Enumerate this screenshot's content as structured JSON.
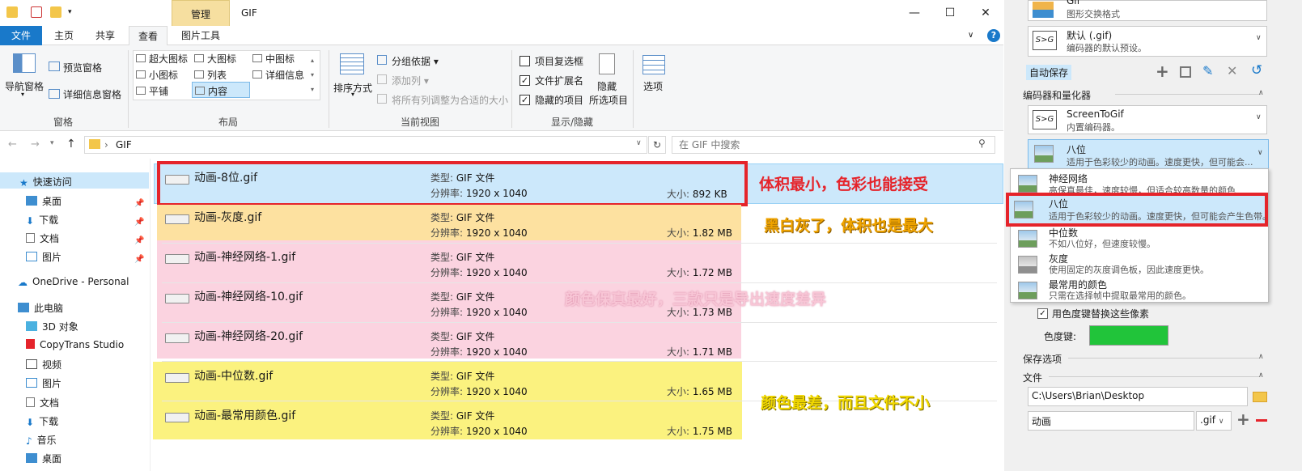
{
  "window": {
    "title": "GIF",
    "context_tab": "管理"
  },
  "ribbon_tabs": [
    "文件",
    "主页",
    "共享",
    "查看",
    "图片工具"
  ],
  "ribbon": {
    "pane_group": {
      "nav_pane": "导航窗格",
      "preview": "预览窗格",
      "details": "详细信息窗格",
      "label": "窗格"
    },
    "layout_group": {
      "items": [
        "超大图标",
        "大图标",
        "中图标",
        "小图标",
        "列表",
        "详细信息",
        "平铺",
        "内容"
      ],
      "label": "布局"
    },
    "view_group": {
      "sort": "排序方式",
      "group_by": "分组依据",
      "add_col": "添加列",
      "fit_cols": "将所有列调整为合适的大小",
      "label": "当前视图"
    },
    "showhide_group": {
      "item_cb": "项目复选框",
      "ext": "文件扩展名",
      "hidden": "隐藏的项目",
      "hide_sel_1": "隐藏",
      "hide_sel_2": "所选项目",
      "label": "显示/隐藏"
    },
    "options": "选项"
  },
  "address": {
    "path": "GIF",
    "search_placeholder": "在 GIF 中搜索"
  },
  "nav": [
    {
      "label": "快速访问"
    },
    {
      "label": "桌面"
    },
    {
      "label": "下载"
    },
    {
      "label": "文档"
    },
    {
      "label": "图片"
    },
    {
      "label": "OneDrive - Personal"
    },
    {
      "label": "此电脑"
    },
    {
      "label": "3D 对象"
    },
    {
      "label": "CopyTrans Studio"
    },
    {
      "label": "视频"
    },
    {
      "label": "图片"
    },
    {
      "label": "文档"
    },
    {
      "label": "下载"
    },
    {
      "label": "音乐"
    },
    {
      "label": "桌面"
    }
  ],
  "files": [
    {
      "name": "动画-8位.gif",
      "type_label": "类型:",
      "type": "GIF 文件",
      "res_label": "分辨率:",
      "res": "1920 x 1040",
      "size_label": "大小:",
      "size": "892 KB"
    },
    {
      "name": "动画-灰度.gif",
      "type_label": "类型:",
      "type": "GIF 文件",
      "res_label": "分辨率:",
      "res": "1920 x 1040",
      "size_label": "大小:",
      "size": "1.82 MB"
    },
    {
      "name": "动画-神经网络-1.gif",
      "type_label": "类型:",
      "type": "GIF 文件",
      "res_label": "分辨率:",
      "res": "1920 x 1040",
      "size_label": "大小:",
      "size": "1.72 MB"
    },
    {
      "name": "动画-神经网络-10.gif",
      "type_label": "类型:",
      "type": "GIF 文件",
      "res_label": "分辨率:",
      "res": "1920 x 1040",
      "size_label": "大小:",
      "size": "1.73 MB"
    },
    {
      "name": "动画-神经网络-20.gif",
      "type_label": "类型:",
      "type": "GIF 文件",
      "res_label": "分辨率:",
      "res": "1920 x 1040",
      "size_label": "大小:",
      "size": "1.71 MB"
    },
    {
      "name": "动画-中位数.gif",
      "type_label": "类型:",
      "type": "GIF 文件",
      "res_label": "分辨率:",
      "res": "1920 x 1040",
      "size_label": "大小:",
      "size": "1.65 MB"
    },
    {
      "name": "动画-最常用颜色.gif",
      "type_label": "类型:",
      "type": "GIF 文件",
      "res_label": "分辨率:",
      "res": "1920 x 1040",
      "size_label": "大小:",
      "size": "1.75 MB"
    }
  ],
  "annotations": {
    "a1": "体积最小，色彩也能接受",
    "a2": "黑白灰了，体积也是最大",
    "a3": "颜色保真最好，三款只是导出速度差异",
    "a4": "颜色最差，而且文件不小"
  },
  "colors": {
    "blue_hl": "#cce8fb",
    "orange_hl": "#fde1a0",
    "pink_hl": "#fbd3e0",
    "yellow_hl": "#fbf27f",
    "red_box": "#e5242b",
    "accent": "#1979ca",
    "chroma_green": "#21c43a"
  },
  "panel": {
    "gif_title": "Gif",
    "gif_sub": "图形交换格式",
    "preset_title": "默认 (.gif)",
    "preset_sub": "编码器的默认预设。",
    "autosave": "自动保存",
    "encoder_header": "编码器和量化器",
    "encoder_title": "ScreenToGif",
    "encoder_sub": "内置编码器。",
    "quant_title": "八位",
    "quant_sub": "适用于色彩较少的动画。速度更快，但可能会...",
    "dropdown": [
      {
        "title": "神经网络",
        "sub": "高保真最佳，速度较慢，但适合较高数量的颜色"
      },
      {
        "title": "八位",
        "sub": "适用于色彩较少的动画。速度更快，但可能会产生色带。"
      },
      {
        "title": "中位数",
        "sub": "不如八位好，但速度较慢。"
      },
      {
        "title": "灰度",
        "sub": "使用固定的灰度调色板，因此速度更快。"
      },
      {
        "title": "最常用的颜色",
        "sub": "只需在选择帧中提取最常用的颜色。"
      }
    ],
    "chroma_cb": "用色度键替换这些像素",
    "chroma_label": "色度键:",
    "save_header": "保存选项",
    "file_header": "文件",
    "folder": "C:\\Users\\Brian\\Desktop",
    "filename": "动画",
    "ext": ".gif"
  }
}
